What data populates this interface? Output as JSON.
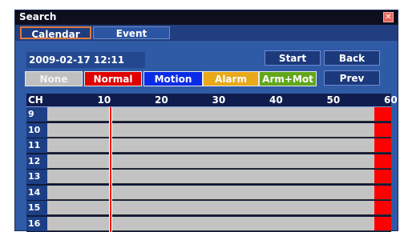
{
  "window": {
    "title": "Search"
  },
  "tabs": [
    {
      "label": "Calendar",
      "active": true
    },
    {
      "label": "Event",
      "active": false
    }
  ],
  "datetime": "2009-02-17 12:11",
  "buttons": {
    "start": "Start",
    "back": "Back",
    "prev": "Prev"
  },
  "legend": [
    {
      "label": "None",
      "color": "#c0c0c0"
    },
    {
      "label": "Normal",
      "color": "#e00000"
    },
    {
      "label": "Motion",
      "color": "#0a2be8"
    },
    {
      "label": "Alarm",
      "color": "#e8a91a"
    },
    {
      "label": "Arm+Mot",
      "color": "#62a71b"
    }
  ],
  "timeline": {
    "header_label": "CH",
    "ticks": [
      "10",
      "20",
      "30",
      "40",
      "50",
      "60"
    ],
    "channels": [
      "9",
      "10",
      "11",
      "12",
      "13",
      "14",
      "15",
      "16"
    ],
    "current_minute": 11,
    "recording_range_minutes": [
      57,
      60
    ]
  }
}
